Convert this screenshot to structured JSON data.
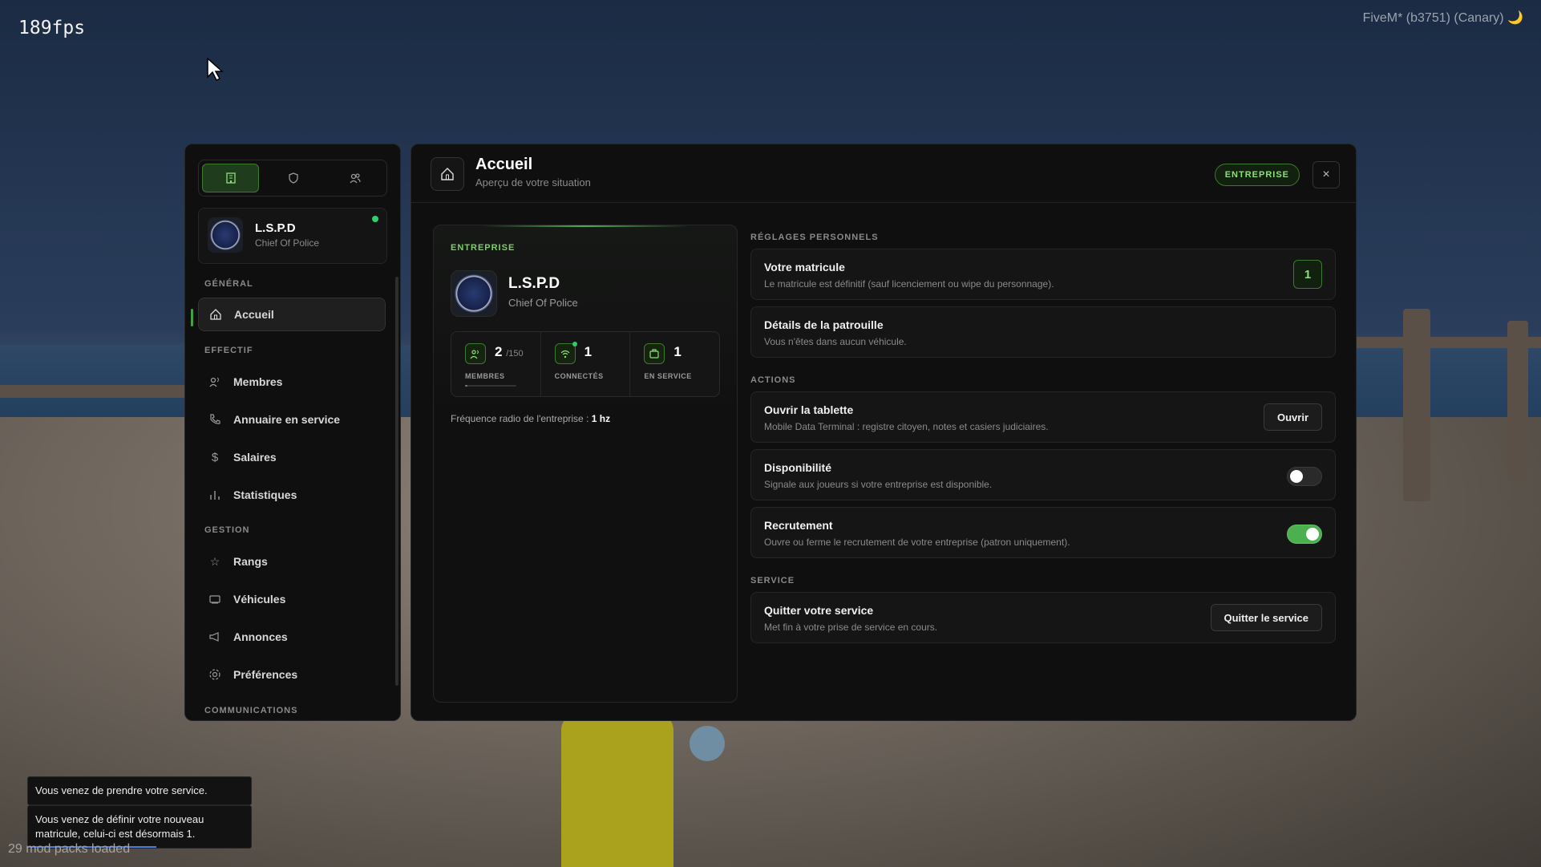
{
  "hud": {
    "fps": "189fps",
    "build": "FiveM* (b3751) (Canary) 🌙",
    "mod_packs": "29 mod packs loaded"
  },
  "sidebar": {
    "tabs": [
      {
        "icon": "building-icon",
        "active": true
      },
      {
        "icon": "shield-icon",
        "active": false
      },
      {
        "icon": "users-icon",
        "active": false
      }
    ],
    "org": {
      "name": "L.S.P.D",
      "role": "Chief Of Police",
      "online": true
    },
    "sections": {
      "general": "GÉNÉRAL",
      "effectif": "EFFECTIF",
      "gestion": "GESTION",
      "communications": "COMMUNICATIONS"
    },
    "items": {
      "accueil": "Accueil",
      "membres": "Membres",
      "annuaire": "Annuaire en service",
      "salaires": "Salaires",
      "statistiques": "Statistiques",
      "rangs": "Rangs",
      "vehicules": "Véhicules",
      "annonces": "Annonces",
      "preferences": "Préférences"
    }
  },
  "header": {
    "title": "Accueil",
    "subtitle": "Aperçu de votre situation",
    "badge": "ENTREPRISE",
    "close": "×"
  },
  "enterprise": {
    "label": "ENTREPRISE",
    "name": "L.S.P.D",
    "role": "Chief Of Police",
    "stats": {
      "members_value": "2",
      "members_max": "/150",
      "members_label": "MEMBRES",
      "members_fill": 0.013,
      "connected_value": "1",
      "connected_label": "CONNECTÉS",
      "service_value": "1",
      "service_label": "EN SERVICE"
    },
    "radio_prefix": "Fréquence radio de l'entreprise :",
    "radio_value": "1 hz"
  },
  "settings": {
    "personal_label": "RÉGLAGES PERSONNELS",
    "matricule_title": "Votre matricule",
    "matricule_desc": "Le matricule est définitif (sauf licenciement ou wipe du personnage).",
    "matricule_value": "1",
    "patrol_title": "Détails de la patrouille",
    "patrol_desc": "Vous n'êtes dans aucun véhicule.",
    "actions_label": "ACTIONS",
    "tablet_title": "Ouvrir la tablette",
    "tablet_desc": "Mobile Data Terminal : registre citoyen, notes et casiers judiciaires.",
    "tablet_btn": "Ouvrir",
    "dispo_title": "Disponibilité",
    "dispo_desc": "Signale aux joueurs si votre entreprise est disponible.",
    "dispo_on": false,
    "recrut_title": "Recrutement",
    "recrut_desc": "Ouvre ou ferme le recrutement de votre entreprise (patron uniquement).",
    "recrut_on": true,
    "service_label": "SERVICE",
    "quit_title": "Quitter votre service",
    "quit_desc": "Met fin à votre prise de service en cours.",
    "quit_btn": "Quitter le service"
  },
  "notifications": [
    "Vous venez de prendre votre service.",
    "Vous venez de définir votre nouveau matricule, celui-ci est désormais 1."
  ],
  "colors": {
    "accent": "#4caf50",
    "accent_text": "#8ee07a",
    "online": "#2fd06c"
  }
}
